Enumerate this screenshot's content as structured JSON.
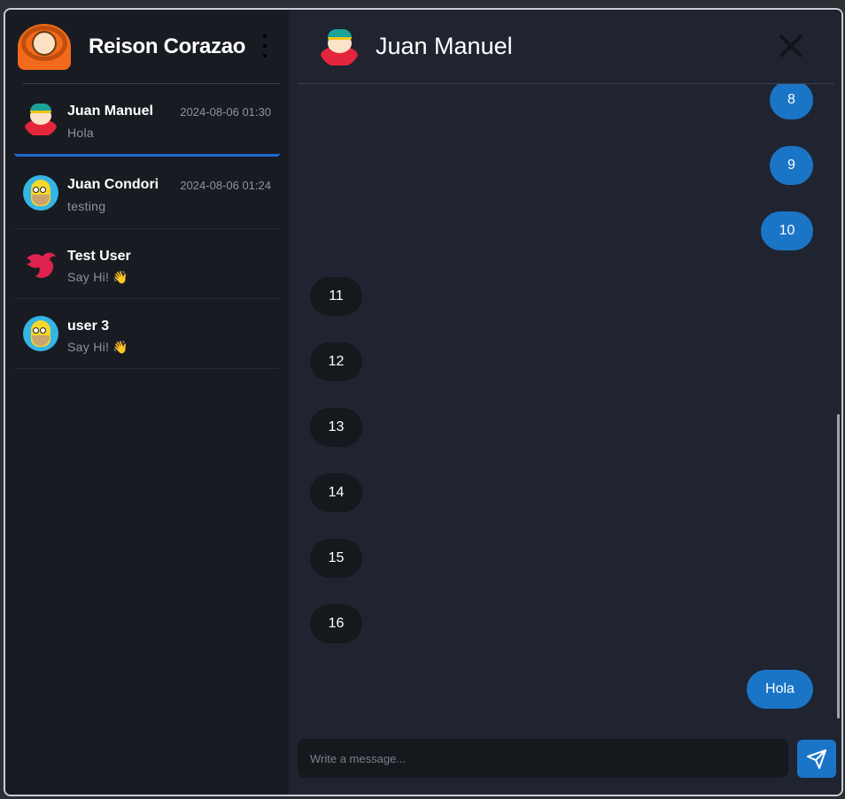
{
  "user": {
    "name": "Reison Corazao",
    "avatar_icon": "kenny-avatar-icon"
  },
  "chats": [
    {
      "name": "Juan Manuel",
      "time": "2024-08-06 01:30",
      "preview": "Hola",
      "avatar_icon": "cartman-avatar-icon",
      "active": true
    },
    {
      "name": "Juan Condori",
      "time": "2024-08-06 01:24",
      "preview": "testing",
      "avatar_icon": "homer-avatar-icon",
      "active": false
    },
    {
      "name": "Test User",
      "time": "",
      "preview": "Say Hi! 👋",
      "avatar_icon": "nestjs-avatar-icon",
      "active": false
    },
    {
      "name": "user 3",
      "time": "",
      "preview": "Say Hi! 👋",
      "avatar_icon": "homer-avatar-icon",
      "active": false
    }
  ],
  "conversation": {
    "title": "Juan Manuel",
    "messages": [
      {
        "text": "8",
        "direction": "out"
      },
      {
        "text": "9",
        "direction": "out"
      },
      {
        "text": "10",
        "direction": "out"
      },
      {
        "text": "11",
        "direction": "in"
      },
      {
        "text": "12",
        "direction": "in"
      },
      {
        "text": "13",
        "direction": "in"
      },
      {
        "text": "14",
        "direction": "in"
      },
      {
        "text": "15",
        "direction": "in"
      },
      {
        "text": "16",
        "direction": "in"
      },
      {
        "text": "Hola",
        "direction": "out"
      }
    ]
  },
  "composer": {
    "placeholder": "Write a message..."
  },
  "colors": {
    "accent": "#1b75c7",
    "sidebar_bg": "#181b21",
    "main_bg": "#1f2430"
  }
}
